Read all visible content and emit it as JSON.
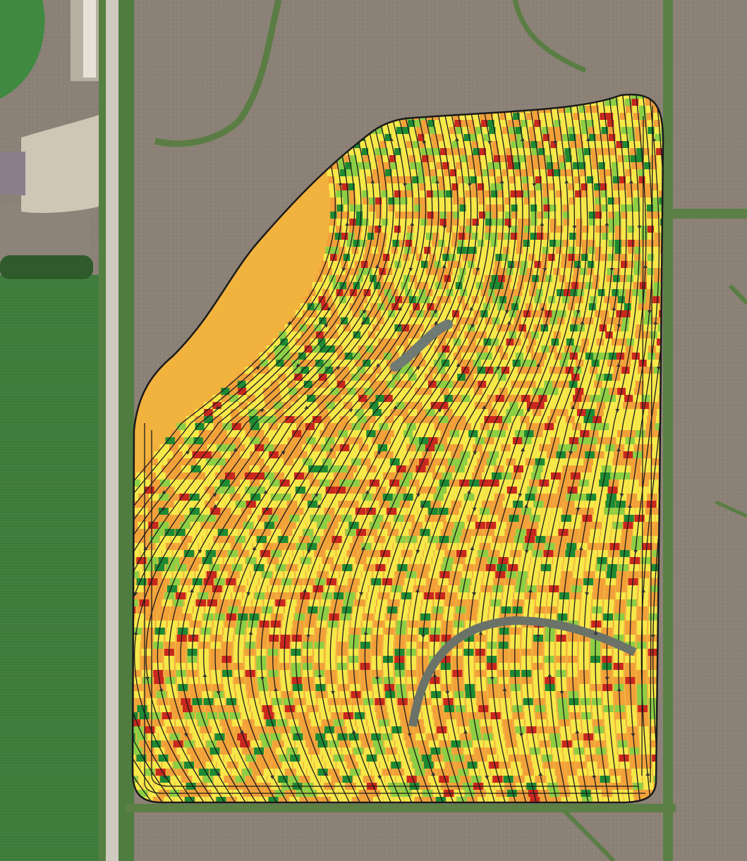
{
  "map": {
    "kind": "aerial imagery with yield map overlay",
    "features": [
      "rural-road",
      "farmstead-building",
      "gravel-yard",
      "tree-row",
      "green-crop-field",
      "tilled-soil-field",
      "grass-waterway",
      "grain-bin",
      "harvest-pass-lines",
      "direction-arrows"
    ],
    "legend_colors": {
      "high": "#1e8a33",
      "above_avg": "#8ccf45",
      "average": "#f7e84a",
      "below_avg": "#f2a13a",
      "low": "#c8281e"
    },
    "soil_color": "#8a8074",
    "crop_color": "#3c7a3a",
    "road_color": "#cfcac0"
  }
}
